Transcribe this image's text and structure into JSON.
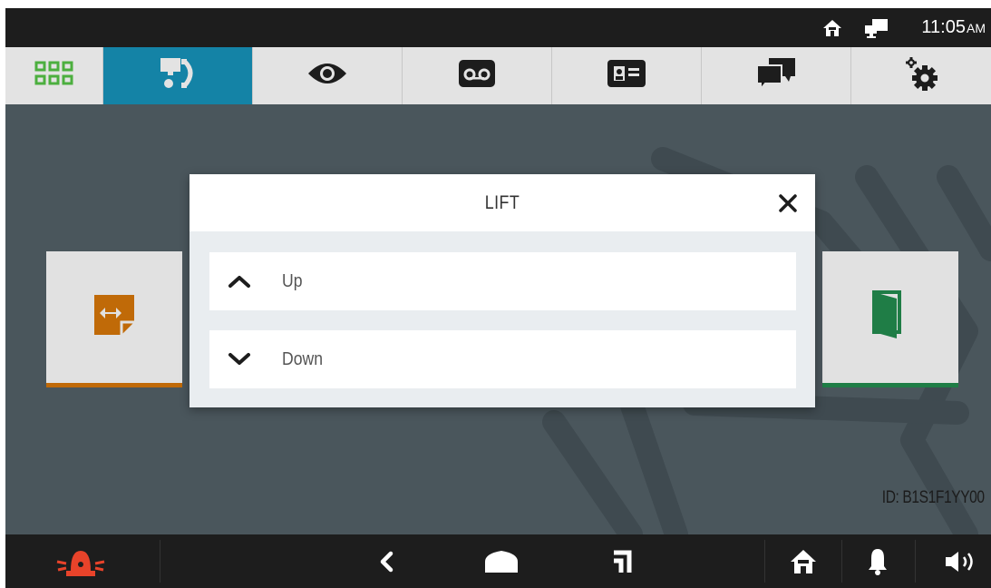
{
  "status_bar": {
    "icons": [
      "home-icon",
      "intercom-device-icon"
    ],
    "time": "11:05",
    "ampm": "AM"
  },
  "tabs": [
    {
      "icon": "grid-icon",
      "active": false
    },
    {
      "icon": "call-icon",
      "active": true
    },
    {
      "icon": "eye-icon",
      "active": false
    },
    {
      "icon": "voicemail-icon",
      "active": false
    },
    {
      "icon": "contact-card-icon",
      "active": false
    },
    {
      "icon": "chat-icon",
      "active": false
    },
    {
      "icon": "settings-icon",
      "active": false
    }
  ],
  "cards": {
    "left": {
      "icon": "lift-panel-icon",
      "color": "#c06a08"
    },
    "right": {
      "icon": "door-icon",
      "color": "#1f7d46"
    }
  },
  "dialog": {
    "title": "LIFT",
    "options": [
      {
        "icon": "chevron-up-icon",
        "label": "Up"
      },
      {
        "icon": "chevron-down-icon",
        "label": "Down"
      }
    ]
  },
  "device_id": "ID: B1S1F1YY00",
  "bottom_bar": {
    "icons": [
      "alarm-icon",
      "back-icon",
      "home-shape-icon",
      "recent-icon",
      "home-icon",
      "bell-icon",
      "volume-icon"
    ],
    "alarm_color": "#e8432a"
  },
  "colors": {
    "accent": "#1483a6",
    "background": "#4a565c",
    "bar": "#1d1d1d"
  }
}
